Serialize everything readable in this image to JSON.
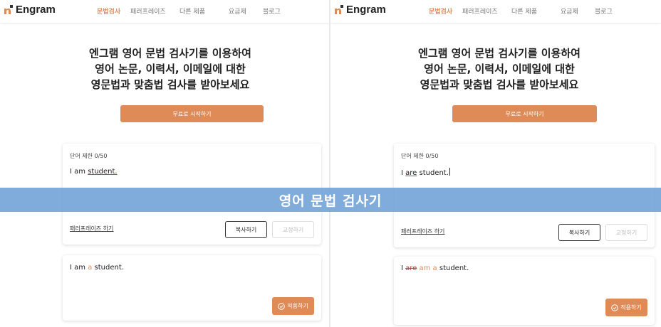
{
  "colors": {
    "accent": "#df8b58",
    "banner": "#6ea0d7",
    "error_underline": "#c9413a"
  },
  "nav": {
    "logo": "Engram",
    "logo_icon": "engram-mark-icon",
    "items": [
      "문법검사",
      "패러프레이즈",
      "다른 제품",
      "요금제",
      "블로그"
    ]
  },
  "hero": {
    "line1": "엔그램 영어 문법 검사기를 이용하여",
    "line2": "영어 논문, 이력서, 이메일에 대한",
    "line3": "영문법과 맞춤법 검사를 받아보세요"
  },
  "cta_label": "무료로 시작하기",
  "panels": [
    {
      "input": {
        "limit_label": "단어 제한 0/50",
        "prefix": "I am ",
        "error_word": "student.",
        "suffix": ""
      },
      "result": {
        "before": "I am ",
        "deleted": "",
        "inserted": "a",
        "after": " student."
      }
    },
    {
      "input": {
        "limit_label": "단어 제한 0/50",
        "prefix": "I ",
        "error_word": "are",
        "suffix": " student."
      },
      "result": {
        "before": "I ",
        "deleted": "are",
        "inserted": "am a",
        "after": " student."
      }
    }
  ],
  "buttons": {
    "paraphrase": "패러프레이즈 하기",
    "copy": "복사하기",
    "correct": "교정하기",
    "apply": "적용하기"
  },
  "banner_text": "영어 문법 검사기"
}
